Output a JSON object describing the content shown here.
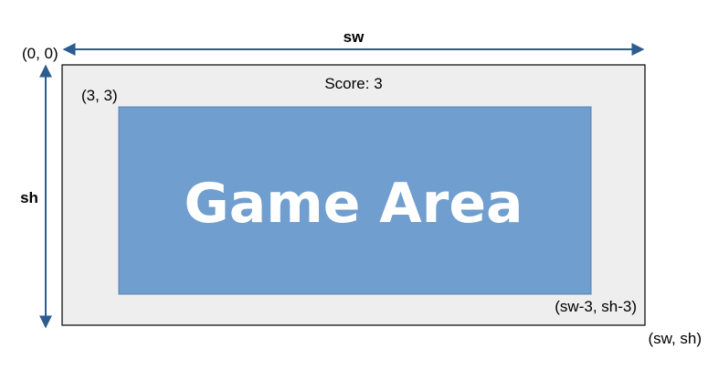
{
  "labels": {
    "width": "sw",
    "height": "sh",
    "origin": "(0, 0)",
    "inner_top_left": "(3, 3)",
    "inner_bottom_right": "(sw-3, sh-3)",
    "outer_bottom_right": "(sw, sh)",
    "score": "Score: 3",
    "game_area": "Game Area"
  },
  "colors": {
    "outer_fill": "#eeeeee",
    "outer_stroke": "#000000",
    "game_area_fill": "#6f9ecf",
    "game_area_stroke": "#5a84b0",
    "arrow": "#2e5c8e"
  }
}
